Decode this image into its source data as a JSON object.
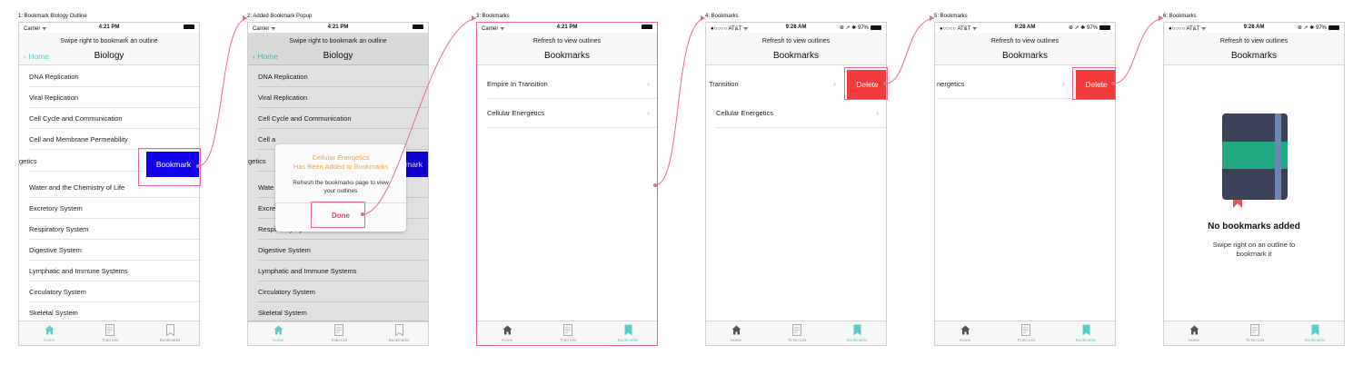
{
  "frames": [
    {
      "label": "1: Bookmark Biology Outline",
      "status": {
        "carrier": "Carrier ᯤ",
        "time": "4:21 PM",
        "right": ""
      },
      "nav": {
        "hint": "Swipe right to bookmark an outline",
        "title": "Biology",
        "back": "‹ Home"
      },
      "rows": [
        "DNA Replication",
        "Viral Replication",
        "Cell Cycle and Communication",
        "Cell and Membrane Permeability",
        "getics",
        "Water and the Chemistry of Life",
        "Excretory System",
        "Respiratory System",
        "Digestive System",
        "Lymphatic and Immune Systems",
        "Circulatory System",
        "Skeletal System"
      ],
      "action": "Bookmark",
      "tabs": [
        "Home",
        "Todo List",
        "Bookmarks"
      ]
    },
    {
      "label": "2: Added Bookmark Popup",
      "status": {
        "carrier": "Carrier ᯤ",
        "time": "4:21 PM",
        "right": ""
      },
      "nav": {
        "hint": "Swipe right to bookmark an outline",
        "title": "Biology",
        "back": "‹ Home"
      },
      "rows": [
        "DNA Replication",
        "Viral Replication",
        "Cell Cycle and Communication",
        "Cell a",
        "getics",
        "Wate",
        "Excre",
        "Respiratory System",
        "Digestive System",
        "Lymphatic and Immune Systems",
        "Circulatory System",
        "Skeletal System"
      ],
      "action": "mark",
      "popup": {
        "title": "Cellular Energetics\nHas Been Added to Bookmarks",
        "message": "Refresh the bookmarks page to view\nyour outlines",
        "button": "Done"
      },
      "tabs": [
        "Home",
        "Todo List",
        "Bookmarks"
      ]
    },
    {
      "label": "3: Bookmarks",
      "status": {
        "carrier": "Carrier ᯤ",
        "time": "4:21 PM",
        "right": ""
      },
      "nav": {
        "hint": "Refresh to view outlines",
        "title": "Bookmarks"
      },
      "rows": [
        "Empire In Transition",
        "Cellular Energetics"
      ],
      "tabs": [
        "Home",
        "Todo List",
        "Bookmarks"
      ]
    },
    {
      "label": "4: Bookmarks",
      "status": {
        "carrier": "●○○○○ AT&T ᯤ",
        "time": "9:28 AM",
        "right": "⊕ ➚ ✱ 97%"
      },
      "nav": {
        "hint": "Refresh to view outlines",
        "title": "Bookmarks"
      },
      "rows": [
        "Transition",
        "Cellular Energetics"
      ],
      "action": "Delete",
      "tabs": [
        "Home",
        "To Do List",
        "Bookmarks"
      ]
    },
    {
      "label": "5: Bookmarks",
      "status": {
        "carrier": "●○○○○ AT&T ᯤ",
        "time": "9:28 AM",
        "right": "⊕ ➚ ✱ 97%"
      },
      "nav": {
        "hint": "Refresh to view outlines",
        "title": "Bookmarks"
      },
      "rows": [
        "nergetics"
      ],
      "action": "Delete",
      "tabs": [
        "Home",
        "To Do List",
        "Bookmarks"
      ]
    },
    {
      "label": "6: Bookmarks",
      "status": {
        "carrier": "●○○○○ AT&T ᯤ",
        "time": "9:28 AM",
        "right": "⊕ ➚ ✱ 97%"
      },
      "nav": {
        "hint": "Refresh to view outlines",
        "title": "Bookmarks"
      },
      "empty": {
        "title": "No bookmarks added",
        "message": "Swipe right on an outline to\nbookmark it"
      },
      "tabs": [
        "Home",
        "To Do List",
        "Bookmarks"
      ]
    }
  ],
  "colors": {
    "accent": "#5bcec4",
    "bookmark": "#1200e8",
    "delete": "#f43b3b",
    "highlight": "#e8679b",
    "popup_title": "#f5a623",
    "done": "#d9427a"
  },
  "icons": {
    "home": "house-icon",
    "todo": "clipboard-icon",
    "bookmarks": "bookmark-icon",
    "empty": "notebook-icon"
  }
}
